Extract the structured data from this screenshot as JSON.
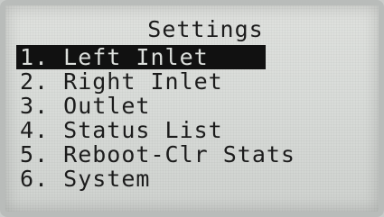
{
  "screen": {
    "title": "Settings"
  },
  "menu": {
    "items": [
      {
        "label": "1. Left Inlet",
        "selected": true
      },
      {
        "label": "2. Right Inlet",
        "selected": false
      },
      {
        "label": "3. Outlet",
        "selected": false
      },
      {
        "label": "4. Status List",
        "selected": false
      },
      {
        "label": "5. Reboot-Clr Stats",
        "selected": false
      },
      {
        "label": "6. System",
        "selected": false
      }
    ]
  },
  "colors": {
    "lcd_background": "#dcdfdc",
    "text": "#1c1c1c",
    "highlight": "#111111"
  }
}
